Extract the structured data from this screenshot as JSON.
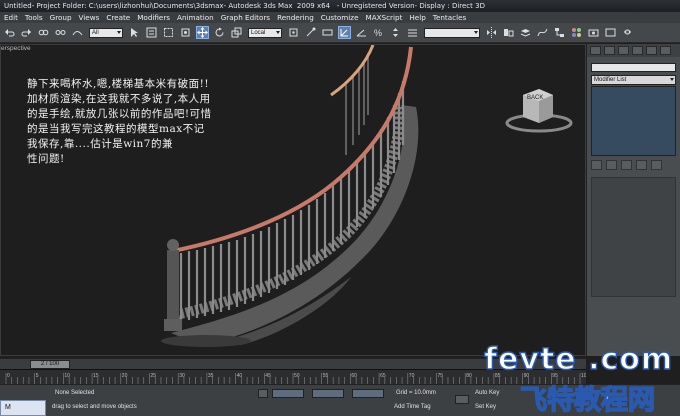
{
  "titlebar": {
    "doc": "Untitled",
    "project": "- Project Folder: C:\\users\\lizhonhui\\Documents\\3dsmax",
    "app": "- Autodesk 3ds Max  2009 x64   - Unregistered Version",
    "display": "- Display : Direct 3D"
  },
  "menu": [
    "Edit",
    "Tools",
    "Group",
    "Views",
    "Create",
    "Modifiers",
    "Animation",
    "Graph Editors",
    "Rendering",
    "Customize",
    "MAXScript",
    "Help",
    "Tentacles"
  ],
  "toolbar": {
    "selection_filter": "All",
    "coord_system": "Local"
  },
  "viewport": {
    "label": "erspective",
    "notes": [
      "静下来喝杯水,嗯,楼梯基本米有破面!!",
      "加材质渲染,在这我就不多说了,本人用",
      "的是手绘,就放几张以前的作品吧!可惜",
      "的是当我写完这教程的模型max不记",
      "我保存,靠....估计是win7的兼",
      "性问题!"
    ],
    "viewcube_label": "BACK"
  },
  "command_panel": {
    "dropdown": "Modifier List"
  },
  "timeline": {
    "frame": "2 / 100"
  },
  "status": {
    "selection": "None Selected",
    "prompt": "drag to select and move objects",
    "grid": "Grid = 10.0mm",
    "add_time_tag": "Add Time Tag",
    "auto_key": "Auto Key",
    "set_key": "Set Key"
  },
  "watermark": {
    "top": "fevte .com",
    "bottom": "飞特教程网"
  },
  "mini_pane": {
    "label": "M"
  },
  "colors": {
    "railing": "#c87a6a",
    "baluster": "#8c8c8c",
    "stringer": "#6a6a6a",
    "accent": "#2a5ab0"
  }
}
